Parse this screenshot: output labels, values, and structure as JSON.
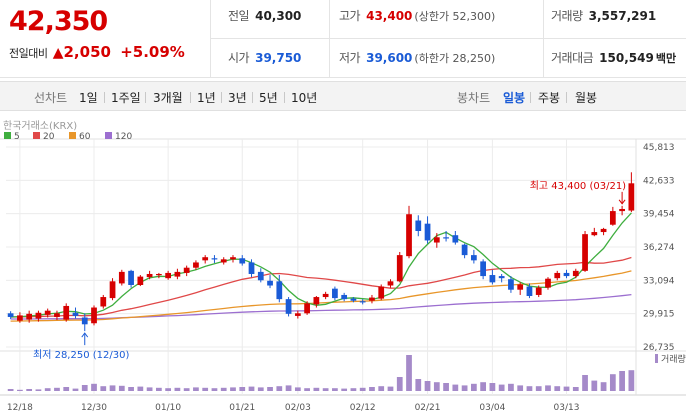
{
  "summary": {
    "current_price": "42,350",
    "change_label": "전일대비",
    "change_arrow": "▲",
    "change_amount": "2,050",
    "change_percent": "+5.09%",
    "prev_close_label": "전일",
    "prev_close": "40,300",
    "high_label": "고가",
    "high": "43,400",
    "upper_limit": "(상한가 52,300)",
    "volume_label": "거래량",
    "volume": "3,557,291",
    "open_label": "시가",
    "open": "39,750",
    "low_label": "저가",
    "low": "39,600",
    "lower_limit": "(하한가 28,250)",
    "amount_label": "거래대금",
    "amount": "150,549",
    "amount_unit": "백만"
  },
  "period_bar": {
    "line_chart_label": "선차트",
    "ranges": [
      "1일",
      "1주일",
      "3개월",
      "1년",
      "3년",
      "5년",
      "10년"
    ],
    "candle_label": "봉차트",
    "candle_types": [
      "일봉",
      "주봉",
      "월봉"
    ],
    "active_candle": "일봉"
  },
  "colors": {
    "up": "#d60000",
    "down": "#1a5bd6",
    "ma5": "#3fae3f",
    "ma20": "#e04848",
    "ma60": "#e8962a",
    "ma120": "#9c6fd0",
    "volume": "#a58ac9"
  },
  "chart_data": {
    "type": "candlestick",
    "source_label": "한국거래소(KRX)",
    "legend": [
      {
        "name": "5",
        "color": "#3fae3f"
      },
      {
        "name": "20",
        "color": "#e04848"
      },
      {
        "name": "60",
        "color": "#e8962a"
      },
      {
        "name": "120",
        "color": "#9c6fd0"
      }
    ],
    "y_ticks": [
      "45,813",
      "42,633",
      "39,454",
      "36,274",
      "33,094",
      "29,915",
      "26,735"
    ],
    "ylim": [
      26735,
      45813
    ],
    "x_tick_labels": [
      "12/18",
      "12/30",
      "01/10",
      "01/21",
      "02/03",
      "02/12",
      "02/21",
      "03/04",
      "03/13"
    ],
    "x_tick_index": [
      1,
      9,
      17,
      25,
      31,
      38,
      45,
      52,
      60
    ],
    "high_annotation": "최고 43,400 (03/21)",
    "low_annotation": "최저 28,250 (12/30)",
    "high_index": 66,
    "low_index": 8,
    "volume_label": "거래량",
    "candles": [
      {
        "o": 29950,
        "h": 30150,
        "l": 29400,
        "c": 29600
      },
      {
        "o": 29250,
        "h": 30050,
        "l": 29050,
        "c": 29750
      },
      {
        "o": 29350,
        "h": 30200,
        "l": 29050,
        "c": 29900
      },
      {
        "o": 29450,
        "h": 30200,
        "l": 29150,
        "c": 30000
      },
      {
        "o": 29800,
        "h": 30400,
        "l": 29550,
        "c": 30200
      },
      {
        "o": 29600,
        "h": 30200,
        "l": 29300,
        "c": 29950
      },
      {
        "o": 29350,
        "h": 30900,
        "l": 29150,
        "c": 30650
      },
      {
        "o": 30000,
        "h": 30500,
        "l": 29450,
        "c": 29700
      },
      {
        "o": 29550,
        "h": 29950,
        "l": 28250,
        "c": 28900
      },
      {
        "o": 29000,
        "h": 30700,
        "l": 28800,
        "c": 30500
      },
      {
        "o": 30600,
        "h": 31700,
        "l": 30400,
        "c": 31500
      },
      {
        "o": 31400,
        "h": 33300,
        "l": 31200,
        "c": 33000
      },
      {
        "o": 32800,
        "h": 34100,
        "l": 32600,
        "c": 33900
      },
      {
        "o": 34000,
        "h": 34100,
        "l": 32400,
        "c": 32650
      },
      {
        "o": 32650,
        "h": 33600,
        "l": 32550,
        "c": 33450
      },
      {
        "o": 33400,
        "h": 34000,
        "l": 33200,
        "c": 33700
      },
      {
        "o": 33600,
        "h": 33800,
        "l": 33300,
        "c": 33700
      },
      {
        "o": 33300,
        "h": 34000,
        "l": 33150,
        "c": 33800
      },
      {
        "o": 33450,
        "h": 34200,
        "l": 33200,
        "c": 33900
      },
      {
        "o": 33800,
        "h": 34500,
        "l": 33500,
        "c": 34300
      },
      {
        "o": 34300,
        "h": 35000,
        "l": 34100,
        "c": 34800
      },
      {
        "o": 35000,
        "h": 35500,
        "l": 34700,
        "c": 35300
      },
      {
        "o": 35200,
        "h": 35500,
        "l": 34750,
        "c": 35100
      },
      {
        "o": 34800,
        "h": 35300,
        "l": 34600,
        "c": 35100
      },
      {
        "o": 35100,
        "h": 35500,
        "l": 34800,
        "c": 35300
      },
      {
        "o": 35200,
        "h": 35500,
        "l": 34500,
        "c": 34700
      },
      {
        "o": 34800,
        "h": 35100,
        "l": 33400,
        "c": 33700
      },
      {
        "o": 33900,
        "h": 34250,
        "l": 32900,
        "c": 33100
      },
      {
        "o": 33050,
        "h": 33600,
        "l": 32350,
        "c": 32600
      },
      {
        "o": 33000,
        "h": 33600,
        "l": 31000,
        "c": 31300
      },
      {
        "o": 31300,
        "h": 31500,
        "l": 29650,
        "c": 29900
      },
      {
        "o": 29700,
        "h": 30200,
        "l": 29450,
        "c": 29950
      },
      {
        "o": 29950,
        "h": 31100,
        "l": 29800,
        "c": 30900
      },
      {
        "o": 30800,
        "h": 31600,
        "l": 30500,
        "c": 31500
      },
      {
        "o": 31500,
        "h": 32000,
        "l": 31300,
        "c": 31800
      },
      {
        "o": 32300,
        "h": 32500,
        "l": 31200,
        "c": 31400
      },
      {
        "o": 31700,
        "h": 31900,
        "l": 31100,
        "c": 31300
      },
      {
        "o": 31350,
        "h": 31500,
        "l": 31000,
        "c": 31150
      },
      {
        "o": 31100,
        "h": 31300,
        "l": 30800,
        "c": 31050
      },
      {
        "o": 31150,
        "h": 31700,
        "l": 30900,
        "c": 31450
      },
      {
        "o": 31350,
        "h": 32700,
        "l": 31200,
        "c": 32500
      },
      {
        "o": 32600,
        "h": 33200,
        "l": 32400,
        "c": 33000
      },
      {
        "o": 33000,
        "h": 35800,
        "l": 32900,
        "c": 35500
      },
      {
        "o": 35400,
        "h": 40200,
        "l": 35200,
        "c": 39400
      },
      {
        "o": 38800,
        "h": 39300,
        "l": 37300,
        "c": 37800
      },
      {
        "o": 38500,
        "h": 39200,
        "l": 36600,
        "c": 36900
      },
      {
        "o": 36700,
        "h": 37600,
        "l": 36200,
        "c": 37200
      },
      {
        "o": 37200,
        "h": 37800,
        "l": 36800,
        "c": 37100
      },
      {
        "o": 37400,
        "h": 37800,
        "l": 36500,
        "c": 36700
      },
      {
        "o": 36500,
        "h": 36600,
        "l": 35200,
        "c": 35500
      },
      {
        "o": 35500,
        "h": 36000,
        "l": 34700,
        "c": 35000
      },
      {
        "o": 34900,
        "h": 35100,
        "l": 33200,
        "c": 33500
      },
      {
        "o": 33600,
        "h": 34100,
        "l": 32700,
        "c": 32900
      },
      {
        "o": 33500,
        "h": 33700,
        "l": 32900,
        "c": 33300
      },
      {
        "o": 33200,
        "h": 33500,
        "l": 31900,
        "c": 32200
      },
      {
        "o": 32200,
        "h": 32900,
        "l": 31700,
        "c": 32700
      },
      {
        "o": 32500,
        "h": 32800,
        "l": 31400,
        "c": 31600
      },
      {
        "o": 31700,
        "h": 32600,
        "l": 31500,
        "c": 32400
      },
      {
        "o": 32400,
        "h": 33400,
        "l": 32200,
        "c": 33250
      },
      {
        "o": 33300,
        "h": 34000,
        "l": 33100,
        "c": 33800
      },
      {
        "o": 33800,
        "h": 34100,
        "l": 33300,
        "c": 33500
      },
      {
        "o": 33500,
        "h": 34200,
        "l": 33300,
        "c": 34000
      },
      {
        "o": 34000,
        "h": 37800,
        "l": 33900,
        "c": 37500
      },
      {
        "o": 37400,
        "h": 38100,
        "l": 37300,
        "c": 37700
      },
      {
        "o": 37700,
        "h": 38100,
        "l": 37400,
        "c": 38000
      },
      {
        "o": 38400,
        "h": 40100,
        "l": 38300,
        "c": 39700
      },
      {
        "o": 39700,
        "h": 40200,
        "l": 39300,
        "c": 39900
      },
      {
        "o": 39750,
        "h": 43400,
        "l": 39600,
        "c": 42350
      }
    ],
    "volumes": [
      5,
      3,
      5,
      4,
      7,
      8,
      10,
      6,
      15,
      18,
      12,
      14,
      13,
      10,
      11,
      9,
      8,
      7,
      8,
      7,
      9,
      8,
      7,
      8,
      9,
      10,
      11,
      9,
      10,
      12,
      14,
      9,
      7,
      8,
      7,
      7,
      6,
      7,
      8,
      10,
      12,
      11,
      35,
      90,
      30,
      25,
      22,
      20,
      16,
      14,
      18,
      22,
      20,
      16,
      18,
      14,
      12,
      12,
      14,
      12,
      11,
      10,
      40,
      26,
      22,
      42,
      50,
      52
    ]
  }
}
